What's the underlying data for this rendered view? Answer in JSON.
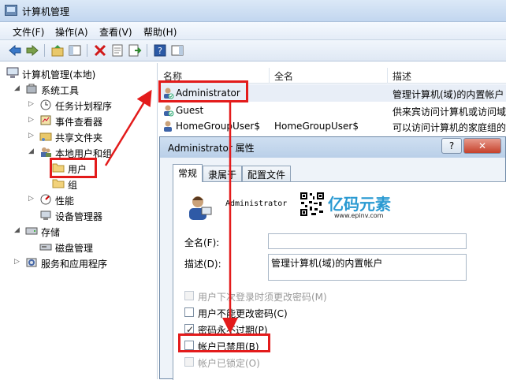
{
  "window": {
    "title": "计算机管理"
  },
  "menu": [
    "文件(F)",
    "操作(A)",
    "查看(V)",
    "帮助(H)"
  ],
  "tree": {
    "root": "计算机管理(本地)",
    "system_tools": "系统工具",
    "task_scheduler": "任务计划程序",
    "event_viewer": "事件查看器",
    "shared_folders": "共享文件夹",
    "local_users_groups": "本地用户和组",
    "users": "用户",
    "groups": "组",
    "performance": "性能",
    "device_manager": "设备管理器",
    "storage": "存储",
    "disk_management": "磁盘管理",
    "services_apps": "服务和应用程序"
  },
  "list": {
    "columns": [
      "名称",
      "全名",
      "描述"
    ],
    "rows": [
      {
        "name": "Administrator",
        "full_name": "",
        "description": "管理计算机(域)的内置帐户"
      },
      {
        "name": "Guest",
        "full_name": "",
        "description": "供来宾访问计算机或访问域"
      },
      {
        "name": "HomeGroupUser$",
        "full_name": "HomeGroupUser$",
        "description": "可以访问计算机的家庭组的"
      }
    ]
  },
  "dialog": {
    "title": "Administrator 属性",
    "help_label": "?",
    "close_label": "✕",
    "tabs": [
      "常规",
      "隶属于",
      "配置文件"
    ],
    "username": "Administrator",
    "logo_text": "亿码元素",
    "logo_url": "www.epinv.com",
    "full_name_label": "全名(F):",
    "full_name_value": "",
    "description_label": "描述(D):",
    "description_value": "管理计算机(域)的内置帐户",
    "checkboxes": [
      {
        "label": "用户下次登录时须更改密码(M)",
        "checked": false,
        "disabled": true
      },
      {
        "label": "用户不能更改密码(C)",
        "checked": false,
        "disabled": false
      },
      {
        "label": "密码永不过期(P)",
        "checked": true,
        "disabled": false
      },
      {
        "label": "帐户已禁用(B)",
        "checked": false,
        "disabled": false
      },
      {
        "label": "帐户已锁定(O)",
        "checked": false,
        "disabled": true
      }
    ]
  },
  "colors": {
    "annotation": "#e31b1b",
    "selection": "#e8eef7",
    "title_bar": "#c2d6ef"
  }
}
